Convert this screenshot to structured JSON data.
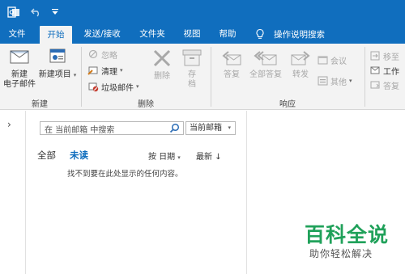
{
  "titlebar": {
    "icons": [
      "outlook-app-icon",
      "undo-icon",
      "customize-qa-icon"
    ],
    "color": "#106ebe"
  },
  "tabs": [
    {
      "label": "文件",
      "active": false
    },
    {
      "label": "开始",
      "active": true
    },
    {
      "label": "发送/接收",
      "active": false
    },
    {
      "label": "文件夹",
      "active": false
    },
    {
      "label": "视图",
      "active": false
    },
    {
      "label": "帮助",
      "active": false
    }
  ],
  "tell_me": {
    "label": "操作说明搜索"
  },
  "ribbon": {
    "new_group": {
      "label": "新建",
      "new_email": "新建\n电子邮件",
      "new_email_l1": "新建",
      "new_email_l2": "电子邮件",
      "new_items": "新建项目"
    },
    "delete_group": {
      "label": "删除",
      "ignore": "忽略",
      "cleanup": "清理",
      "junk": "垃圾邮件",
      "delete": "删除",
      "archive_l1": "存",
      "archive_l2": "档"
    },
    "respond_group": {
      "label": "响应",
      "reply": "答复",
      "reply_all": "全部答复",
      "forward": "转发",
      "meeting": "会议",
      "more": "其他"
    },
    "quicksteps_group": {
      "move_to": "移至",
      "to_manager": "工作",
      "reply_delete": "答复"
    }
  },
  "list": {
    "search_placeholder": "在 当前邮箱 中搜索",
    "scope": "当前邮箱",
    "filter_all": "全部",
    "filter_unread": "未读",
    "sort_by": "按 日期",
    "order": "最新",
    "empty_message": "找不到要在此处显示的任何内容。"
  },
  "watermark": {
    "title": "百科全说",
    "subtitle": "助你轻松解决"
  }
}
